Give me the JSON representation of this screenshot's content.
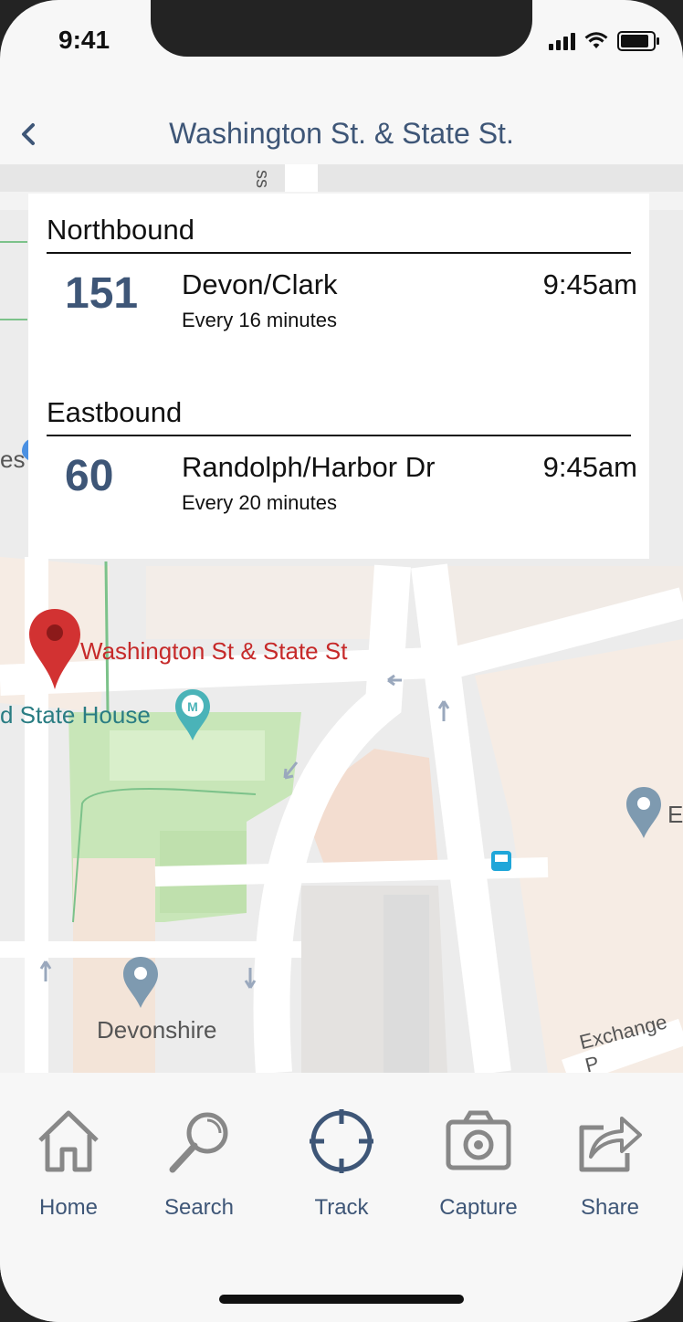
{
  "status_bar": {
    "time": "9:41"
  },
  "header": {
    "title": "Washington St. & State St."
  },
  "map": {
    "pin_label": "Washington St & State St",
    "poi_labels": [
      "d State House",
      "Devonshire",
      "E",
      "es"
    ],
    "street_labels": [
      "Exchange P",
      "ss"
    ]
  },
  "departures": {
    "sections": [
      {
        "title": "Northbound",
        "routes": [
          {
            "number": "151",
            "destination": "Devon/Clark",
            "frequency": "Every 16 minutes",
            "time": "9:45am"
          }
        ]
      },
      {
        "title": "Eastbound",
        "routes": [
          {
            "number": "60",
            "destination": "Randolph/Harbor Dr",
            "frequency": "Every 20 minutes",
            "time": "9:45am"
          }
        ]
      }
    ]
  },
  "tabbar": {
    "items": [
      {
        "label": "Home",
        "icon": "home-icon",
        "active": false
      },
      {
        "label": "Search",
        "icon": "search-icon",
        "active": false
      },
      {
        "label": "Track",
        "icon": "target-icon",
        "active": true
      },
      {
        "label": "Capture",
        "icon": "camera-icon",
        "active": false
      },
      {
        "label": "Share",
        "icon": "share-icon",
        "active": false
      }
    ]
  },
  "colors": {
    "accent": "#3e5677",
    "pin": "#d23232",
    "park": "#c8e6b8"
  }
}
